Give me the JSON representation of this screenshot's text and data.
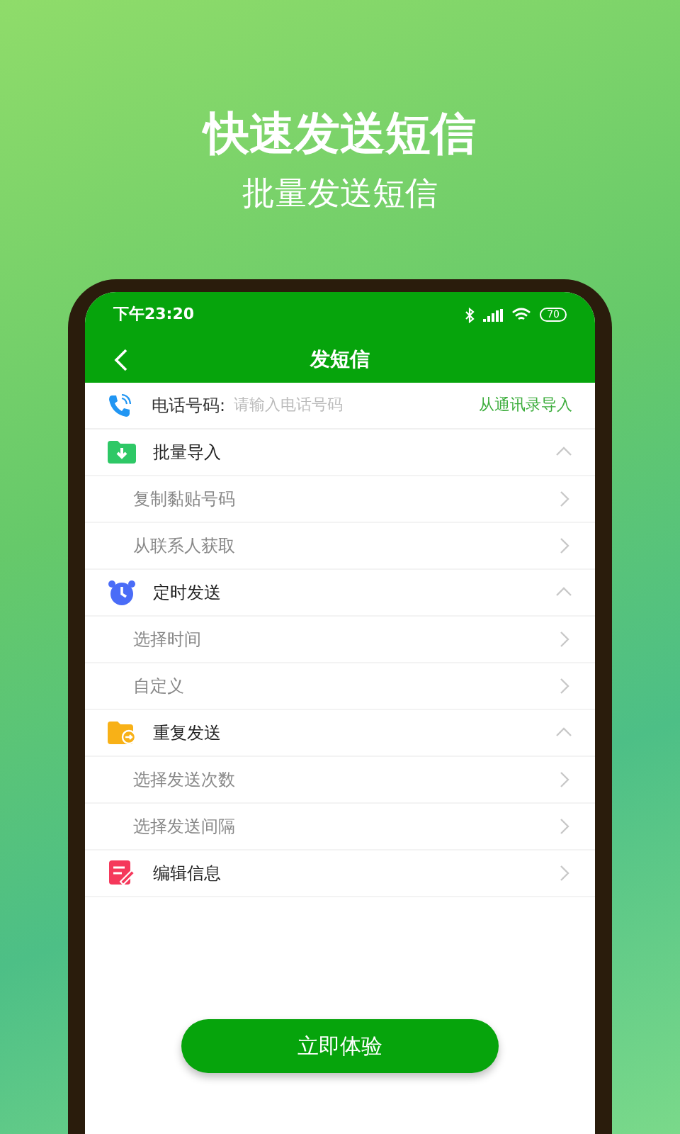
{
  "headline": "快速发送短信",
  "subheadline": "批量发送短信",
  "status_bar": {
    "time": "下午23:20",
    "battery": "70"
  },
  "nav": {
    "title": "发短信"
  },
  "phone_field": {
    "label": "电话号码:",
    "placeholder": "请输入电话号码",
    "action": "从通讯录导入"
  },
  "sections": [
    {
      "kind": "section",
      "label": "批量导入",
      "expanded": true,
      "children": [
        {
          "label": "复制黏贴号码"
        },
        {
          "label": "从联系人获取"
        }
      ]
    },
    {
      "kind": "section",
      "label": "定时发送",
      "expanded": true,
      "children": [
        {
          "label": "选择时间"
        },
        {
          "label": "自定义"
        }
      ]
    },
    {
      "kind": "section",
      "label": "重复发送",
      "expanded": true,
      "children": [
        {
          "label": "选择发送次数"
        },
        {
          "label": "选择发送间隔"
        }
      ]
    },
    {
      "kind": "link",
      "label": "编辑信息"
    }
  ],
  "primary_button": "立即体验"
}
